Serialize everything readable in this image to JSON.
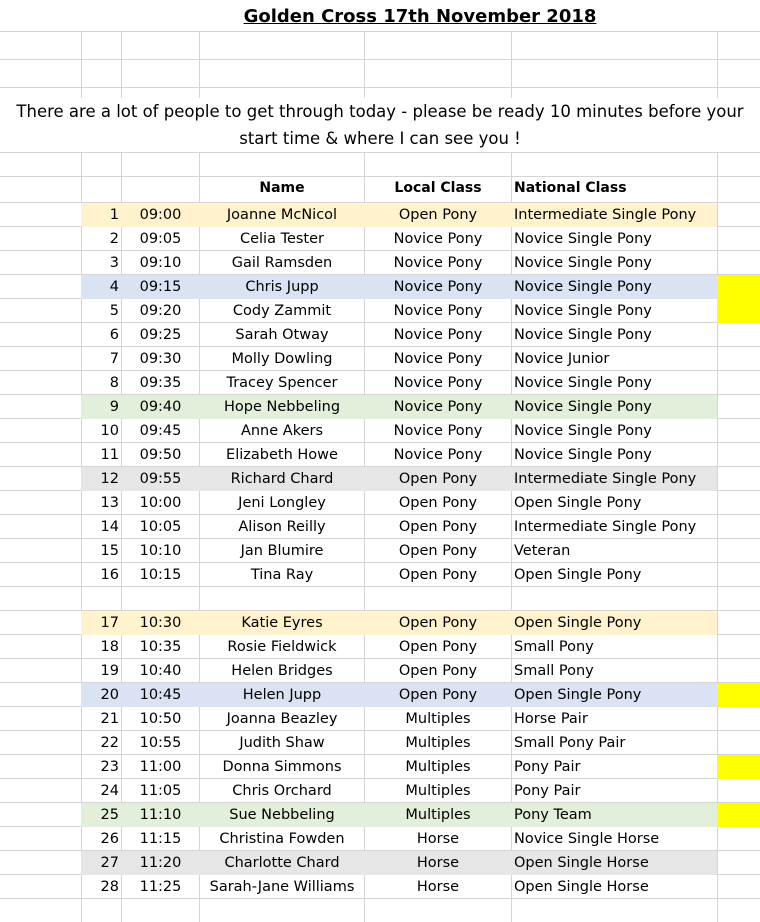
{
  "title": "Golden Cross 17th November 2018",
  "notice": {
    "line1": "There are a lot of people to get through today - please be ready 10 minutes before your",
    "line2": "start time & where I can see you !"
  },
  "headers": {
    "name": "Name",
    "local": "Local Class",
    "national": "National Class"
  },
  "colors": {
    "orange": "#fff2cc",
    "blue": "#dae3f3",
    "green": "#e2efda",
    "grey": "#e7e6e6",
    "marker": "#ffff00",
    "grid": "#d4d4d4"
  },
  "rows": [
    {
      "num": "1",
      "time": "09:00",
      "name": "Joanne McNicol",
      "local": "Open Pony",
      "national": "Intermediate Single Pony",
      "band": "orange",
      "marker": false
    },
    {
      "num": "2",
      "time": "09:05",
      "name": "Celia Tester",
      "local": "Novice Pony",
      "national": "Novice Single Pony",
      "band": "",
      "marker": false
    },
    {
      "num": "3",
      "time": "09:10",
      "name": "Gail Ramsden",
      "local": "Novice Pony",
      "national": "Novice Single Pony",
      "band": "",
      "marker": false
    },
    {
      "num": "4",
      "time": "09:15",
      "name": "Chris Jupp",
      "local": "Novice Pony",
      "national": "Novice Single Pony",
      "band": "blue",
      "marker": true
    },
    {
      "num": "5",
      "time": "09:20",
      "name": "Cody Zammit",
      "local": "Novice Pony",
      "national": "Novice Single Pony",
      "band": "",
      "marker": true
    },
    {
      "num": "6",
      "time": "09:25",
      "name": "Sarah Otway",
      "local": "Novice Pony",
      "national": "Novice Single Pony",
      "band": "",
      "marker": false
    },
    {
      "num": "7",
      "time": "09:30",
      "name": "Molly Dowling",
      "local": "Novice Pony",
      "national": "Novice Junior",
      "band": "",
      "marker": false
    },
    {
      "num": "8",
      "time": "09:35",
      "name": "Tracey Spencer",
      "local": "Novice Pony",
      "national": "Novice Single Pony",
      "band": "",
      "marker": false
    },
    {
      "num": "9",
      "time": "09:40",
      "name": "Hope Nebbeling",
      "local": "Novice Pony",
      "national": "Novice Single Pony",
      "band": "green",
      "marker": false
    },
    {
      "num": "10",
      "time": "09:45",
      "name": "Anne Akers",
      "local": "Novice Pony",
      "national": "Novice Single Pony",
      "band": "",
      "marker": false
    },
    {
      "num": "11",
      "time": "09:50",
      "name": "Elizabeth Howe",
      "local": "Novice Pony",
      "national": "Novice Single Pony",
      "band": "",
      "marker": false
    },
    {
      "num": "12",
      "time": "09:55",
      "name": "Richard Chard",
      "local": "Open Pony",
      "national": "Intermediate Single Pony",
      "band": "grey",
      "marker": false
    },
    {
      "num": "13",
      "time": "10:00",
      "name": "Jeni Longley",
      "local": "Open Pony",
      "national": "Open Single Pony",
      "band": "",
      "marker": false
    },
    {
      "num": "14",
      "time": "10:05",
      "name": "Alison Reilly",
      "local": "Open Pony",
      "national": "Intermediate Single Pony",
      "band": "",
      "marker": false
    },
    {
      "num": "15",
      "time": "10:10",
      "name": "Jan Blumire",
      "local": "Open Pony",
      "national": "Veteran",
      "band": "",
      "marker": false
    },
    {
      "num": "16",
      "time": "10:15",
      "name": "Tina Ray",
      "local": "Open Pony",
      "national": "Open Single Pony",
      "band": "",
      "marker": false
    },
    {
      "num": "",
      "time": "",
      "name": "",
      "local": "",
      "national": "",
      "band": "",
      "marker": false
    },
    {
      "num": "17",
      "time": "10:30",
      "name": "Katie Eyres",
      "local": "Open Pony",
      "national": "Open Single Pony",
      "band": "orange",
      "marker": false
    },
    {
      "num": "18",
      "time": "10:35",
      "name": "Rosie Fieldwick",
      "local": "Open Pony",
      "national": "Small Pony",
      "band": "",
      "marker": false
    },
    {
      "num": "19",
      "time": "10:40",
      "name": "Helen Bridges",
      "local": "Open Pony",
      "national": "Small Pony",
      "band": "",
      "marker": false
    },
    {
      "num": "20",
      "time": "10:45",
      "name": "Helen Jupp",
      "local": "Open Pony",
      "national": "Open Single Pony",
      "band": "blue",
      "marker": true
    },
    {
      "num": "21",
      "time": "10:50",
      "name": "Joanna Beazley",
      "local": "Multiples",
      "national": "Horse Pair",
      "band": "",
      "marker": false
    },
    {
      "num": "22",
      "time": "10:55",
      "name": "Judith Shaw",
      "local": "Multiples",
      "national": "Small Pony Pair",
      "band": "",
      "marker": false
    },
    {
      "num": "23",
      "time": "11:00",
      "name": "Donna Simmons",
      "local": "Multiples",
      "national": "Pony Pair",
      "band": "",
      "marker": true
    },
    {
      "num": "24",
      "time": "11:05",
      "name": "Chris Orchard",
      "local": "Multiples",
      "national": "Pony Pair",
      "band": "",
      "marker": false
    },
    {
      "num": "25",
      "time": "11:10",
      "name": "Sue Nebbeling",
      "local": "Multiples",
      "national": "Pony Team",
      "band": "green",
      "marker": true
    },
    {
      "num": "26",
      "time": "11:15",
      "name": "Christina Fowden",
      "local": "Horse",
      "national": "Novice Single Horse",
      "band": "",
      "marker": false
    },
    {
      "num": "27",
      "time": "11:20",
      "name": "Charlotte Chard",
      "local": "Horse",
      "national": "Open Single Horse",
      "band": "grey",
      "marker": false
    },
    {
      "num": "28",
      "time": "11:25",
      "name": "Sarah-Jane Williams",
      "local": "Horse",
      "national": "Open Single Horse",
      "band": "",
      "marker": false
    }
  ]
}
